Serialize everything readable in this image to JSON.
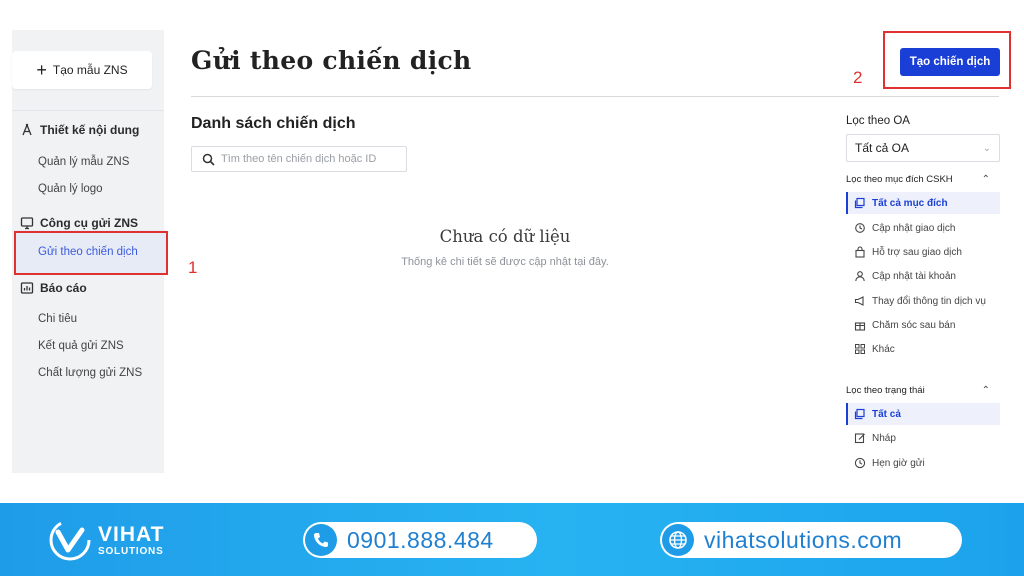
{
  "sidebar": {
    "create_template_label": "Tạo mẫu ZNS",
    "sections": {
      "design": {
        "label": "Thiết kế nội dung",
        "items": [
          "Quản lý mẫu ZNS",
          "Quản lý logo"
        ]
      },
      "send_tools": {
        "label": "Công cụ gửi ZNS",
        "items": [
          "Gửi theo chiến dịch"
        ]
      },
      "reports": {
        "label": "Báo cáo",
        "items": [
          "Chi tiêu",
          "Kết quả gửi ZNS",
          "Chất lượng gửi ZNS"
        ]
      }
    }
  },
  "main": {
    "page_title": "Gửi theo chiến dịch",
    "create_campaign_label": "Tạo chiến dịch",
    "list_title": "Danh sách chiến dịch",
    "search_placeholder": "Tìm theo tên chiến dịch hoặc ID",
    "empty_title": "Chưa có dữ liệu",
    "empty_subtitle": "Thống kê chi tiết sẽ được cập nhật tại đây."
  },
  "filters": {
    "oa_label": "Lọc theo OA",
    "oa_selected": "Tất cả OA",
    "purpose_label": "Lọc theo mục đích CSKH",
    "purpose_items": [
      "Tất cả mục đích",
      "Cập nhật giao dịch",
      "Hỗ trợ sau giao dịch",
      "Cập nhật tài khoản",
      "Thay đổi thông tin dịch vụ",
      "Chăm sóc sau bán",
      "Khác"
    ],
    "status_label": "Lọc theo trạng thái",
    "status_items": [
      "Tất cả",
      "Nháp",
      "Hẹn giờ gửi"
    ]
  },
  "annotations": {
    "one": "1",
    "two": "2"
  },
  "footer": {
    "brand": "VIHAT",
    "brand_sub": "SOLUTIONS",
    "phone": "0901.888.484",
    "website": "vihatsolutions.com"
  },
  "colors": {
    "accent": "#1a3fd6",
    "annotation": "#e03131",
    "footer": "#1f9ce8"
  }
}
